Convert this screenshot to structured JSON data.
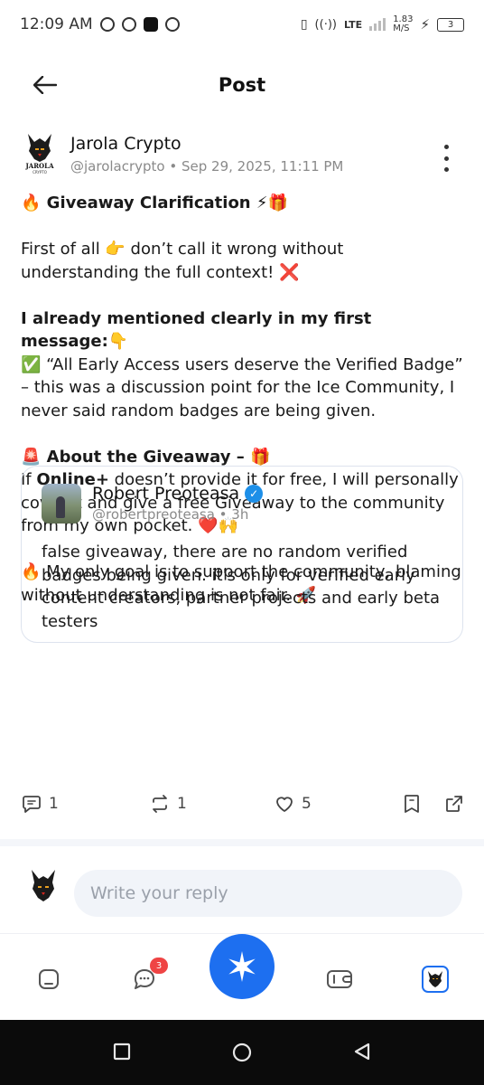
{
  "status_bar": {
    "time": "12:09 AM",
    "network_type": "LTE",
    "speed_value": "1.83",
    "speed_unit": "M/S",
    "battery_level": "3"
  },
  "header": {
    "title": "Post"
  },
  "post": {
    "author_name": "Jarola Crypto",
    "author_handle": "@jarolacrypto",
    "timestamp": "Sep 29, 2025, 11:11 PM",
    "paragraphs": [
      "🔥 Giveaway Clarification ⚡🎁",
      "First of all 👉 don’t call it wrong without understanding the full context! ❌",
      "I already mentioned clearly in my first message:👇",
      "✅ “All Early Access users deserve the Verified Badge” – this was a discussion point for the Ice Community, I never said random badges are being given.",
      "🚨 About the Giveaway – 🎁",
      "If ",
      "Online+",
      " doesn’t provide it for free, I will personally cover it and give a free Giveaway to the community from my own pocket. ❤️🙌",
      "🔥 My only goal is to support the community, blaming without understanding is not fair. 🚀"
    ],
    "quote": {
      "author_name": "Robert Preoteasa",
      "author_handle": "@robertpreoteasa",
      "time_ago": "3h",
      "text": "false giveaway, there are no random verified badges being given. it's only for verified early content creators, partner projects and early beta testers"
    },
    "actions": {
      "comments": "1",
      "reposts": "1",
      "likes": "5"
    }
  },
  "reply": {
    "placeholder": "Write your reply"
  },
  "bottom_nav": {
    "chat_badge": "3"
  },
  "logo_text": {
    "main": "JAROLA",
    "sub": "CRYPTO"
  },
  "colors": {
    "accent": "#1d6ff0",
    "verified": "#1d8fe8",
    "badge": "#ef4444",
    "muted_text": "#8a8a8a"
  }
}
